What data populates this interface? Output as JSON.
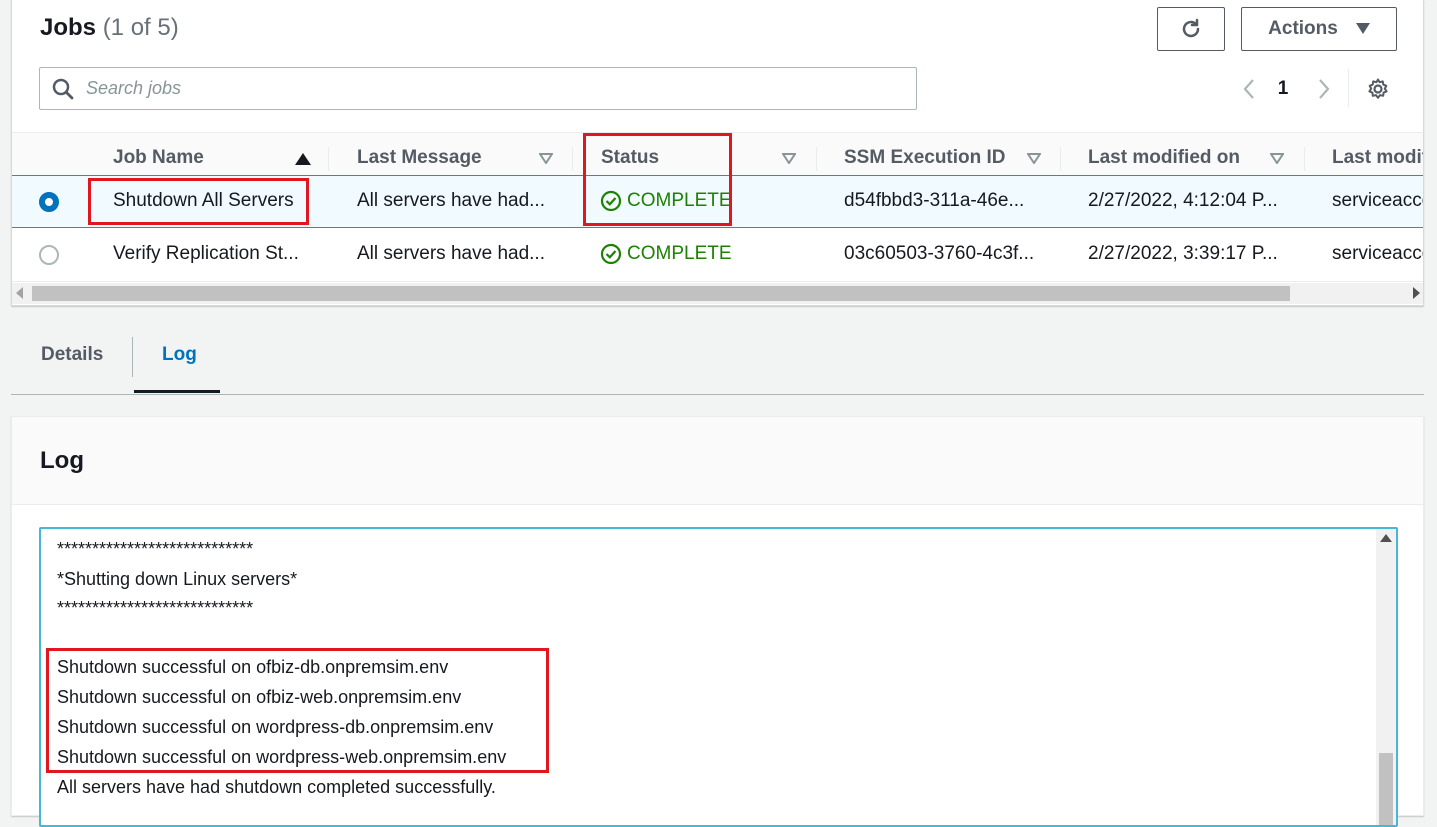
{
  "jobs": {
    "title": "Jobs",
    "count": "(1 of 5)",
    "actions_label": "Actions",
    "search_placeholder": "Search jobs",
    "page_number": "1",
    "columns": [
      "Job Name",
      "Last Message",
      "Status",
      "SSM Execution ID",
      "Last modified on",
      "Last modif"
    ],
    "rows": [
      {
        "name": "Shutdown All Servers",
        "message": "All servers have had...",
        "status": "COMPLETE",
        "ssm_id": "d54fbbd3-311a-46e...",
        "modified_on": "2/27/2022, 4:12:04 P...",
        "modified_by": "serviceacco",
        "selected": true
      },
      {
        "name": "Verify Replication St...",
        "message": "All servers have had...",
        "status": "COMPLETE",
        "ssm_id": "03c60503-3760-4c3f...",
        "modified_on": "2/27/2022, 3:39:17 P...",
        "modified_by": "serviceacco",
        "selected": false
      }
    ]
  },
  "tabs": {
    "details": "Details",
    "log": "Log",
    "active": "Log"
  },
  "log": {
    "title": "Log",
    "lines": [
      "****************************",
      "*Shutting down Linux servers*",
      "****************************",
      "",
      "Shutdown successful on ofbiz-db.onpremsim.env",
      "Shutdown successful on ofbiz-web.onpremsim.env",
      "Shutdown successful on wordpress-db.onpremsim.env",
      "Shutdown successful on wordpress-web.onpremsim.env",
      "All servers have had shutdown completed successfully."
    ]
  },
  "colors": {
    "accent": "#0073bb",
    "success": "#1d8102",
    "highlight": "#e0171f",
    "selected_row": "#f1faff"
  },
  "icons": [
    "refresh-icon",
    "caret-down-icon",
    "search-icon",
    "chevron-left-icon",
    "chevron-right-icon",
    "gear-icon",
    "sort-up-icon",
    "sort-down-icon",
    "check-circle-icon"
  ]
}
